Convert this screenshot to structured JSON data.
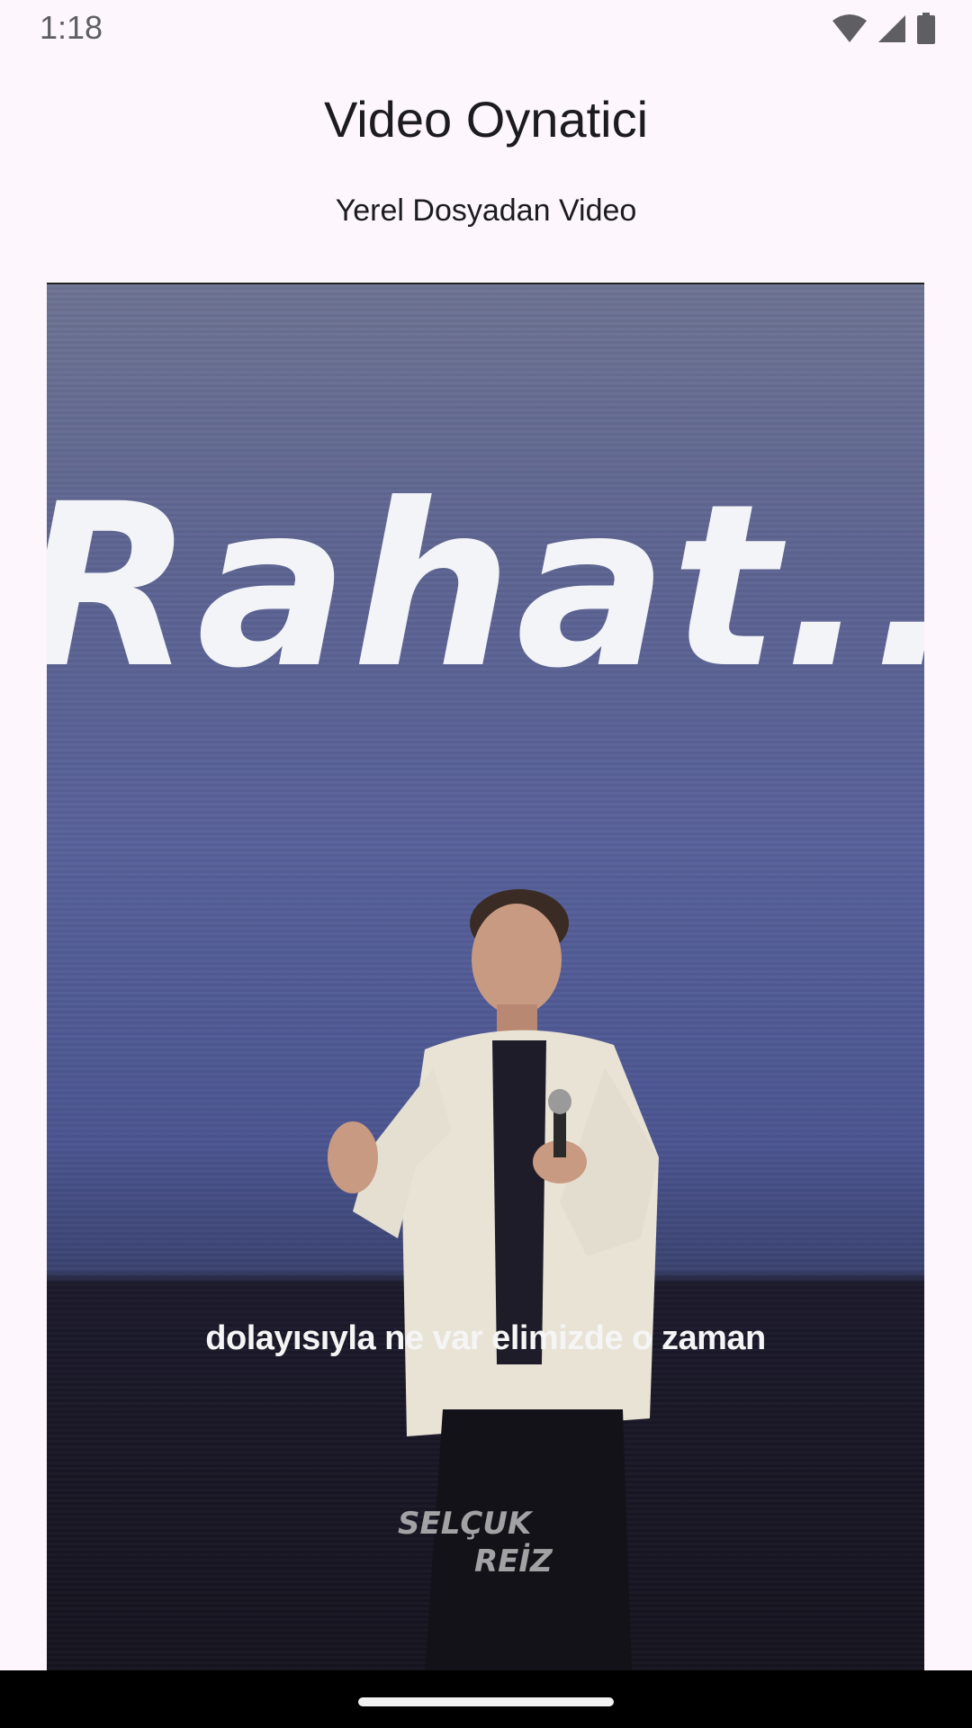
{
  "status_bar": {
    "time": "1:18",
    "icons": [
      "wifi-icon",
      "cellular-signal-icon",
      "battery-icon"
    ]
  },
  "header": {
    "title": "Video Oynatici",
    "subtitle": "Yerel Dosyadan Video"
  },
  "video": {
    "screen_text": "Rahat...",
    "caption": "dolayısıyla ne var elimizde o zaman",
    "watermark": "SELÇUK REİZ"
  },
  "colors": {
    "background": "#fdf6fc",
    "text": "#1c1b1f",
    "nav_bar": "#000000"
  }
}
